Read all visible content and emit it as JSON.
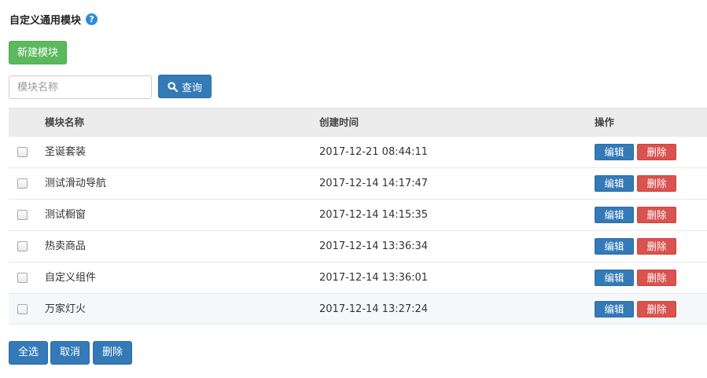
{
  "header": {
    "title": "自定义通用模块",
    "help_glyph": "?"
  },
  "toolbar": {
    "new_module_label": "新建模块"
  },
  "search": {
    "placeholder": "模块名称",
    "value": "",
    "button_label": "查询",
    "icon": "search-icon"
  },
  "table": {
    "columns": [
      "模块名称",
      "创建时间",
      "操作"
    ],
    "rows": [
      {
        "name": "圣诞套装",
        "created": "2017-12-21 08:44:11"
      },
      {
        "name": "测试滑动导航",
        "created": "2017-12-14 14:17:47"
      },
      {
        "name": "测试橱窗",
        "created": "2017-12-14 14:15:35"
      },
      {
        "name": "热卖商品",
        "created": "2017-12-14 13:36:34"
      },
      {
        "name": "自定义组件",
        "created": "2017-12-14 13:36:01"
      },
      {
        "name": "万家灯火",
        "created": "2017-12-14 13:27:24"
      }
    ],
    "edit_label": "编辑",
    "delete_label": "删除"
  },
  "footer": {
    "select_all_label": "全选",
    "cancel_label": "取消",
    "delete_label": "删除"
  },
  "colors": {
    "green": "#5cb85c",
    "blue": "#337ab7",
    "red": "#d9534f",
    "help": "#2d8bd9"
  }
}
